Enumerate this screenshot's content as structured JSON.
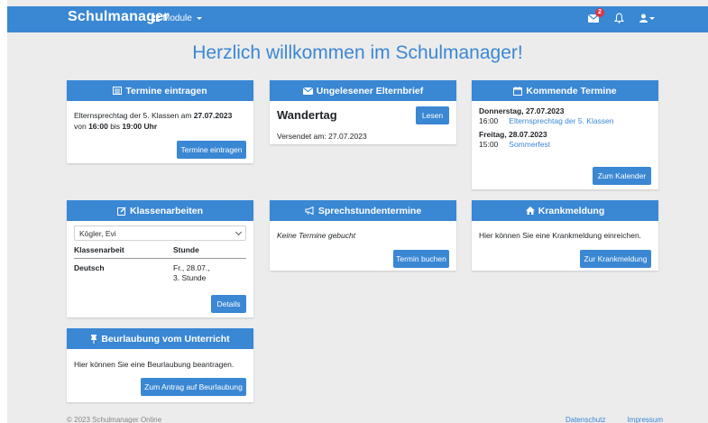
{
  "navbar": {
    "brand": "Schulmanager",
    "module_label": "Module",
    "mail_badge": "2"
  },
  "page_title": "Herzlich willkommen im Schulmanager!",
  "termine_eintragen": {
    "header": "Termine eintragen",
    "text_prefix": "Elternsprechtag der 5. Klassen am ",
    "date": "27.07.2023",
    "text_mid": " von ",
    "from": "16:00",
    "text_bis": " bis ",
    "to": "19:00 Uhr",
    "button": "Termine eintragen"
  },
  "elternbrief": {
    "header": "Ungelesener Elternbrief",
    "title": "Wandertag",
    "button": "Lesen",
    "sent": "Versendet am: 27.07.2023"
  },
  "kommende_termine": {
    "header": "Kommende Termine",
    "days": [
      {
        "day": "Donnerstag, 27.07.2023",
        "time": "16:00",
        "event": "Elternsprechtag der 5. Klassen"
      },
      {
        "day": "Freitag, 28.07.2023",
        "time": "15:00",
        "event": "Sommerfest"
      }
    ],
    "button": "Zum Kalender"
  },
  "klassenarbeiten": {
    "header": "Klassenarbeiten",
    "selected_student": "Kögler, Evi",
    "columns": [
      "Klassenarbeit",
      "Stunde"
    ],
    "rows": [
      {
        "subject": "Deutsch",
        "when_line1": "Fr., 28.07.,",
        "when_line2": "3. Stunde"
      }
    ],
    "button": "Details"
  },
  "sprechstunden": {
    "header": "Sprechstundentermine",
    "text": "Keine Termine gebucht",
    "button": "Termin buchen"
  },
  "krankmeldung": {
    "header": "Krankmeldung",
    "text": "Hier können Sie eine Krankmeldung einreichen.",
    "button": "Zur Krankmeldung"
  },
  "beurlaubung": {
    "header": "Beurlaubung vom Unterricht",
    "text": "Hier können Sie eine Beurlaubung beantragen.",
    "button": "Zum Antrag auf Beurlaubung"
  },
  "footer": {
    "copyright": "© 2023 Schulmanager Online",
    "datenschutz": "Datenschutz",
    "impressum": "Impressum"
  },
  "colors": {
    "primary": "#3a87d4",
    "background": "#ececec",
    "badge": "#dc3545"
  }
}
